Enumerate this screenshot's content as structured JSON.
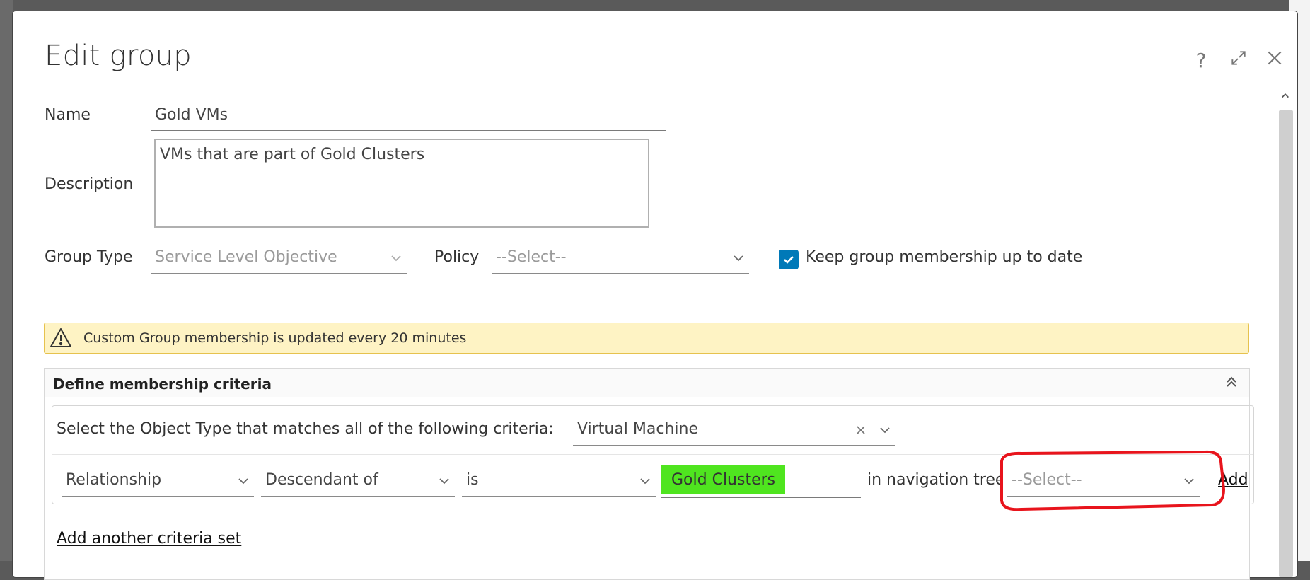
{
  "dialog": {
    "title": "Edit group"
  },
  "form": {
    "name_label": "Name",
    "name_value": "Gold VMs",
    "description_label": "Description",
    "description_value": "VMs that are part of Gold Clusters",
    "group_type_label": "Group Type",
    "group_type_value": "Service Level Objective",
    "policy_label": "Policy",
    "policy_value": "--Select--",
    "keep_membership_label": "Keep group membership up to date",
    "keep_membership_checked": true
  },
  "alert": {
    "message": "Custom Group membership is updated every 20 minutes"
  },
  "criteria": {
    "section_title": "Define membership criteria",
    "object_type_prompt": "Select the Object Type that matches all of the following criteria:",
    "object_type_value": "Virtual Machine",
    "row": {
      "type": "Relationship",
      "relation": "Descendant of",
      "operator": "is",
      "value": "Gold Clusters",
      "tree_label": "in navigation tree",
      "tree_value": "--Select--",
      "add_label": "Add"
    },
    "add_set_label": "Add another criteria set"
  },
  "colors": {
    "accent": "#0079b8",
    "highlight": "#4fe51f",
    "annotation": "#e8141c",
    "alert_bg": "#fef3c4"
  },
  "icons": [
    "help-icon",
    "expand-icon",
    "close-icon",
    "chevron-down-icon",
    "warning-icon",
    "collapse-up-icon",
    "clear-icon",
    "check-icon"
  ]
}
